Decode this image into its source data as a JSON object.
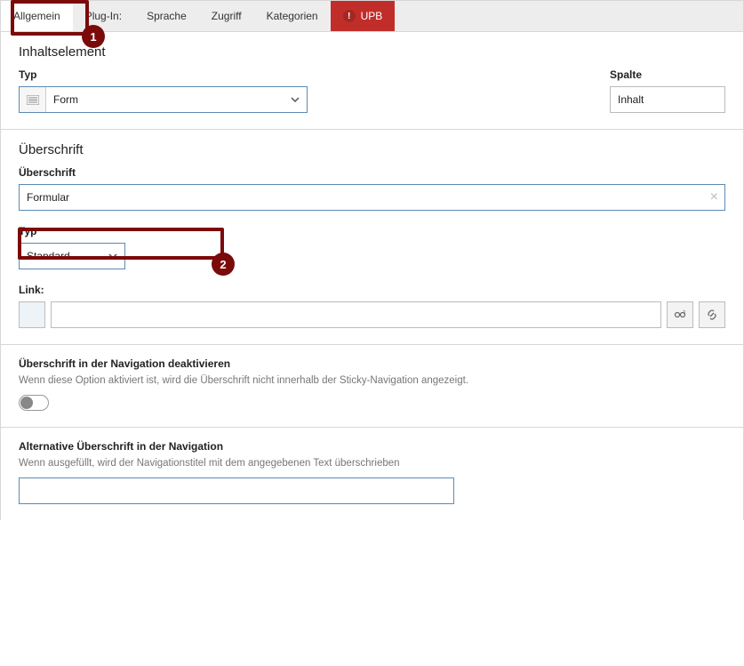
{
  "tabs": {
    "allgemein": "Allgemein",
    "plugin": "Plug-In:",
    "sprache": "Sprache",
    "zugriff": "Zugriff",
    "kategorien": "Kategorien",
    "upb": "UPB"
  },
  "inhaltselement": {
    "title": "Inhaltselement",
    "typ_label": "Typ",
    "typ_value": "Form",
    "spalte_label": "Spalte",
    "spalte_value": "Inhalt"
  },
  "ueberschrift": {
    "title": "Überschrift",
    "label": "Überschrift",
    "value": "Formular",
    "typ_label": "Typ",
    "typ_value": "Standard",
    "link_label": "Link:",
    "link_value": ""
  },
  "nav_disable": {
    "label": "Überschrift in der Navigation deaktivieren",
    "help": "Wenn diese Option aktiviert ist, wird die Überschrift nicht innerhalb der Sticky-Navigation angezeigt.",
    "value": false
  },
  "nav_alt": {
    "label": "Alternative Überschrift in der Navigation",
    "help": "Wenn ausgefüllt, wird der Navigationstitel mit dem angegebenen Text überschrieben",
    "value": ""
  },
  "annotations": {
    "n1": "1",
    "n2": "2"
  }
}
